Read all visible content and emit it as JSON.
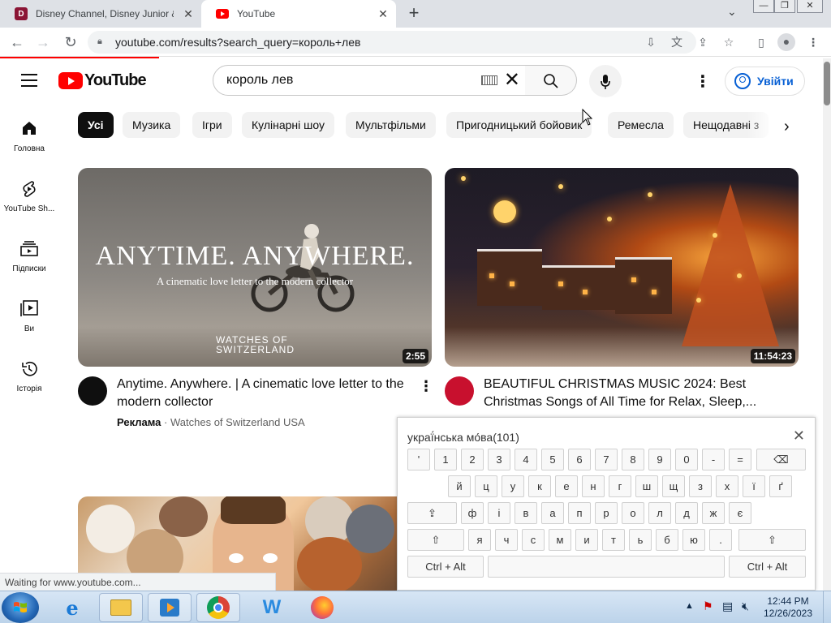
{
  "browser": {
    "tabs": [
      {
        "title": "Disney Channel, Disney Junior & ",
        "favicon": "disney-icon"
      },
      {
        "title": "YouTube",
        "favicon": "youtube-icon"
      }
    ],
    "url": "youtube.com/results?search_query=король+лев",
    "status_text": "Waiting for www.youtube.com..."
  },
  "youtube": {
    "logo_text": "YouTube",
    "search_query": "король лев",
    "signin_label": "Увійти",
    "chips": [
      "Усі",
      "Музика",
      "Ігри",
      "Кулінарні шоу",
      "Мультфільми",
      "Пригодницький бойовик",
      "Ремесла",
      "Нещодавні з"
    ],
    "active_chip_index": 0,
    "rail": [
      {
        "label": "Головна",
        "icon": "home-icon"
      },
      {
        "label": "YouTube Sh...",
        "icon": "shorts-icon"
      },
      {
        "label": "Підписки",
        "icon": "subscriptions-icon"
      },
      {
        "label": "Ви",
        "icon": "library-icon"
      },
      {
        "label": "Історія",
        "icon": "history-icon"
      }
    ],
    "videos": [
      {
        "title": "Anytime. Anywhere. | A cinematic love letter to the modern collector",
        "thumb_headline": "ANYTIME. ANYWHERE.",
        "thumb_subline": "A cinematic love letter to the modern collector",
        "thumb_brand_line1": "WATCHES OF",
        "thumb_brand_line2": "SWITZERLAND",
        "duration": "2:55",
        "badge": "Реклама",
        "channel": "Watches of Switzerland USA",
        "separator": "·"
      },
      {
        "title": "BEAUTIFUL CHRISTMAS MUSIC 2024: Best Christmas Songs of All Time for Relax, Sleep,...",
        "duration": "11:54:23"
      }
    ]
  },
  "keyboard": {
    "title": "украї́нська мо́ва(101)",
    "row1": [
      "'",
      "1",
      "2",
      "3",
      "4",
      "5",
      "6",
      "7",
      "8",
      "9",
      "0",
      "-",
      "="
    ],
    "row2": [
      "й",
      "ц",
      "у",
      "к",
      "е",
      "н",
      "г",
      "ш",
      "щ",
      "з",
      "х",
      "ї",
      "ґ"
    ],
    "row3": [
      "ф",
      "і",
      "в",
      "а",
      "п",
      "р",
      "о",
      "л",
      "д",
      "ж",
      "є"
    ],
    "row4": [
      "я",
      "ч",
      "с",
      "м",
      "и",
      "т",
      "ь",
      "б",
      "ю",
      "."
    ],
    "ctrl_alt": "Ctrl + Alt"
  },
  "taskbar": {
    "time": "12:44 PM",
    "date": "12/26/2023"
  }
}
